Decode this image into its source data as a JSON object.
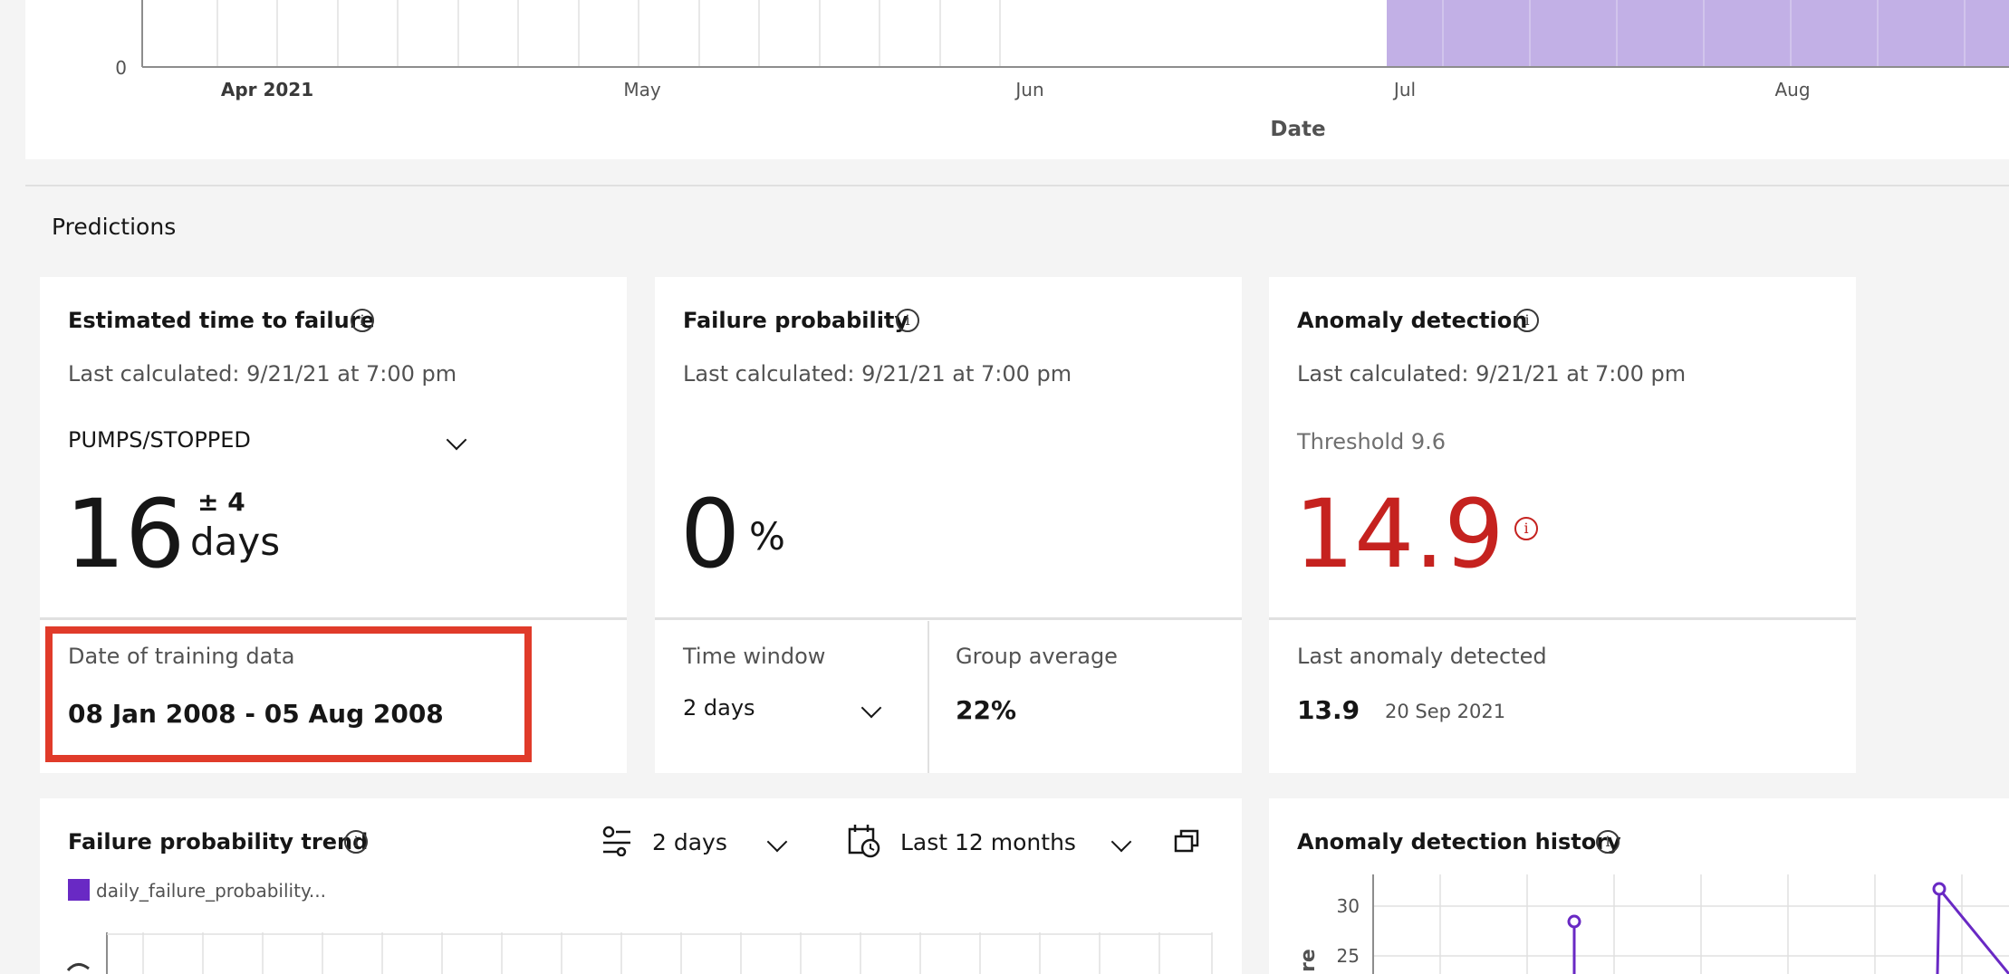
{
  "top_chart": {
    "y_tick": "0",
    "x_ticks": [
      "Apr 2021",
      "May",
      "Jun",
      "Jul",
      "Aug"
    ],
    "x_axis_title": "Date",
    "highlight_color": "#c2b0e6"
  },
  "predictions": {
    "section_title": "Predictions",
    "ettf": {
      "title": "Estimated time to failure",
      "last_calculated": "Last calculated: 9/21/21 at 7:00 pm",
      "dropdown_value": "PUMPS/STOPPED",
      "value": "16",
      "plus_minus": "± 4",
      "unit": "days",
      "training_label": "Date of training data",
      "training_range": "08 Jan 2008 - 05 Aug 2008"
    },
    "failure_probability": {
      "title": "Failure probability",
      "last_calculated": "Last calculated: 9/21/21 at 7:00 pm",
      "value": "0",
      "unit": "%",
      "time_window_label": "Time window",
      "time_window_value": "2 days",
      "group_average_label": "Group average",
      "group_average_value": "22%"
    },
    "anomaly_detection": {
      "title": "Anomaly detection",
      "last_calculated": "Last calculated: 9/21/21 at 7:00 pm",
      "threshold": "Threshold 9.6",
      "value": "14.9",
      "value_color": "#c5221f",
      "last_anomaly_label": "Last anomaly detected",
      "last_anomaly_value": "13.9",
      "last_anomaly_date": "20 Sep 2021"
    }
  },
  "trend": {
    "title": "Failure probability trend",
    "window_value": "2 days",
    "range_value": "Last 12 months",
    "legend_label": "daily_failure_probability...",
    "legend_color": "#6929c4"
  },
  "anomaly_history": {
    "title": "Anomaly detection history",
    "y_ticks": [
      "30",
      "25"
    ],
    "y_axis_title_fragment": "re",
    "line_color": "#6929c4"
  }
}
